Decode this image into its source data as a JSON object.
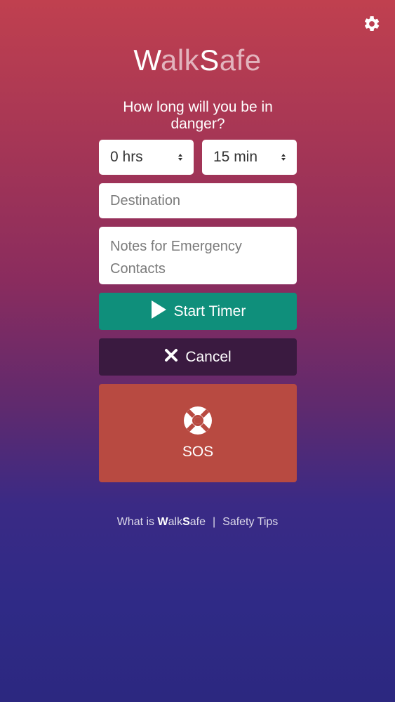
{
  "header": {
    "settings_icon": "gear-icon"
  },
  "logo": {
    "part1": "W",
    "part2": "alk",
    "part3": "S",
    "part4": "afe"
  },
  "form": {
    "question": "How long will you be in danger?",
    "hours_select": {
      "value": "0 hrs"
    },
    "minutes_select": {
      "value": "15 min"
    },
    "destination": {
      "placeholder": "Destination"
    },
    "notes": {
      "placeholder": "Notes for Emergency Contacts"
    }
  },
  "buttons": {
    "start_timer": {
      "label": "Start Timer",
      "icon": "play-icon",
      "color": "#0f8f7b"
    },
    "cancel": {
      "label": "Cancel",
      "icon": "close-icon",
      "color": "#3a1a40"
    },
    "sos": {
      "label": "SOS",
      "icon": "life-ring-icon",
      "color": "#b84a41"
    }
  },
  "footer": {
    "about_prefix": "What is ",
    "about_brand_w": "W",
    "about_brand_alk": "alk",
    "about_brand_s": "S",
    "about_brand_afe": "afe",
    "separator": "|",
    "tips": "Safety Tips"
  }
}
